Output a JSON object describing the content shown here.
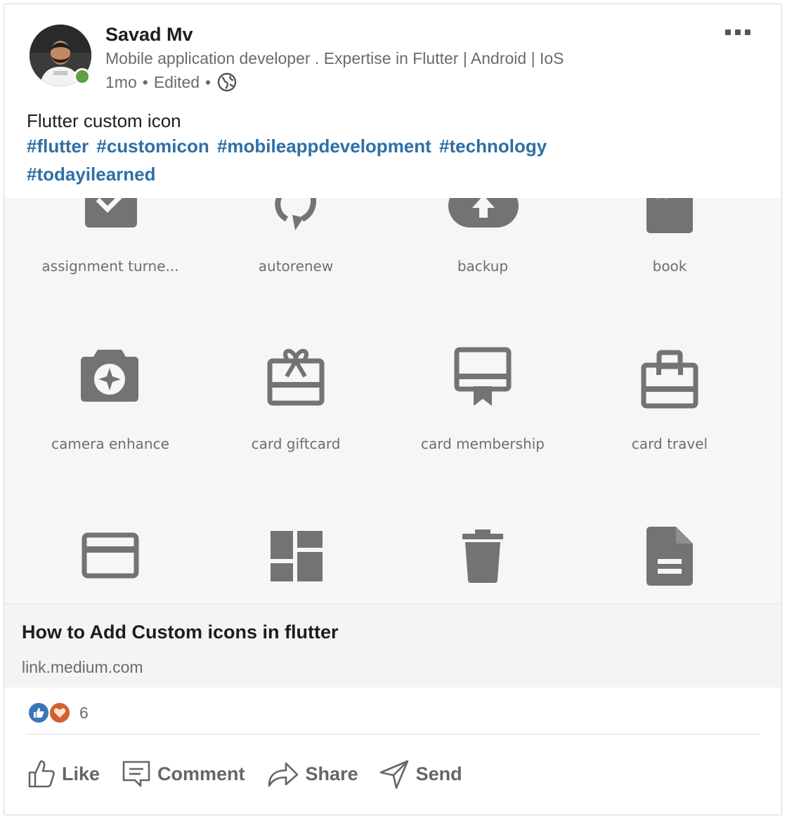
{
  "author": {
    "name": "Savad Mv",
    "headline": "Mobile application developer . Expertise in Flutter | Android | IoS",
    "time": "1mo",
    "edited": "Edited",
    "separator": "•",
    "visibility_icon": "globe-icon",
    "online_color": "#5f9f3f"
  },
  "more_icon": "ellipsis-icon",
  "post": {
    "text": "Flutter custom icon",
    "hashtags": [
      "#flutter",
      "#customicon",
      "#mobileappdevelopment",
      "#technology",
      "#todayilearned"
    ],
    "hashtag_color": "#2d6fa7"
  },
  "preview": {
    "icons": [
      {
        "icon": "assignment-turned-in-icon",
        "label": "assignment turne..."
      },
      {
        "icon": "autorenew-icon",
        "label": "autorenew"
      },
      {
        "icon": "backup-icon",
        "label": "backup"
      },
      {
        "icon": "book-icon",
        "label": "book"
      },
      {
        "icon": "camera-enhance-icon",
        "label": "camera enhance"
      },
      {
        "icon": "card-giftcard-icon",
        "label": "card giftcard"
      },
      {
        "icon": "card-membership-icon",
        "label": "card membership"
      },
      {
        "icon": "card-travel-icon",
        "label": "card travel"
      },
      {
        "icon": "credit-card-icon",
        "label": ""
      },
      {
        "icon": "dashboard-icon",
        "label": ""
      },
      {
        "icon": "delete-icon",
        "label": ""
      },
      {
        "icon": "description-icon",
        "label": ""
      }
    ]
  },
  "link": {
    "title": "How to Add Custom icons in flutter",
    "url": "link.medium.com"
  },
  "reactions": {
    "types": [
      "like-reaction-icon",
      "love-reaction-icon"
    ],
    "count": "6"
  },
  "actions": [
    {
      "icon": "like-icon",
      "label": "Like"
    },
    {
      "icon": "comment-icon",
      "label": "Comment"
    },
    {
      "icon": "share-icon",
      "label": "Share"
    },
    {
      "icon": "send-icon",
      "label": "Send"
    }
  ]
}
